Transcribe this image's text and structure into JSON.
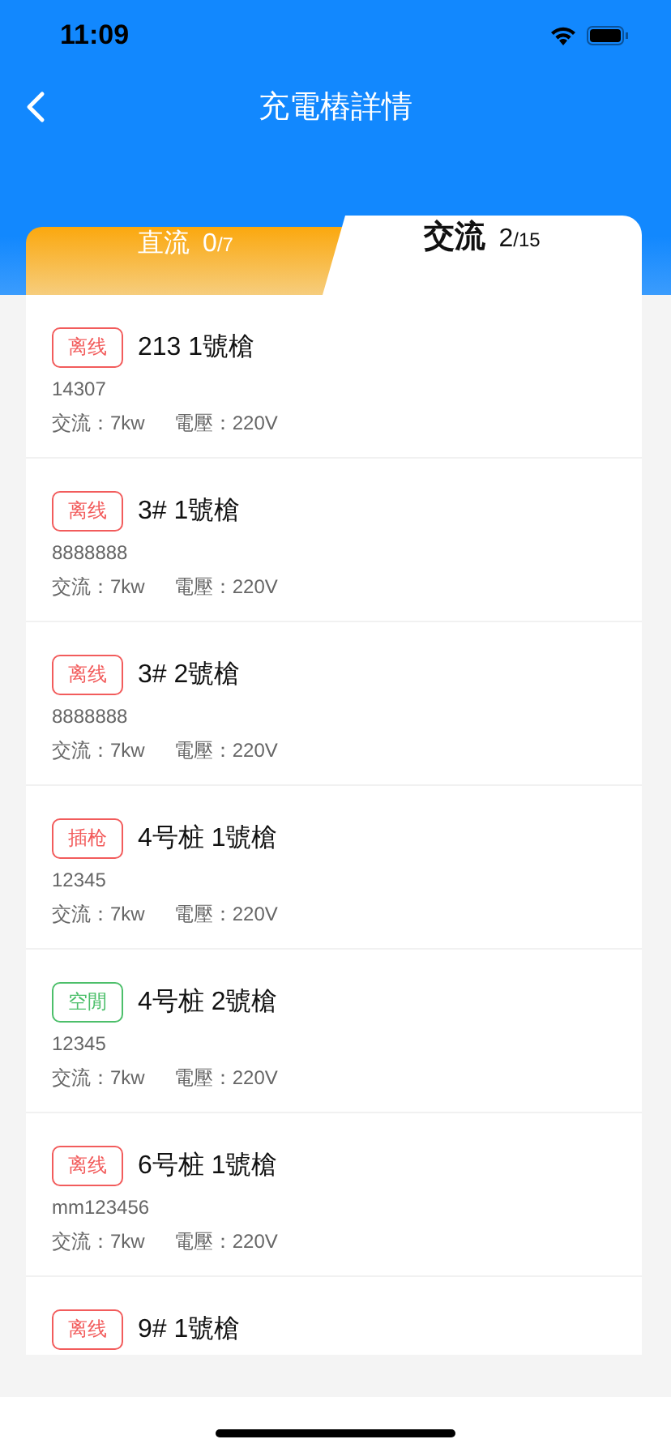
{
  "status_bar": {
    "time": "11:09"
  },
  "header": {
    "title": "充電樁詳情"
  },
  "tabs": [
    {
      "label": "直流",
      "count": "0",
      "total": "/7",
      "selected": false
    },
    {
      "label": "交流",
      "count": "2",
      "total": "/15",
      "selected": true
    }
  ],
  "guns": [
    {
      "status": "离线",
      "color": "#f25c5c",
      "name": "213 1號槍",
      "code": "14307",
      "power": "交流：7kw",
      "voltage": "電壓：220V"
    },
    {
      "status": "离线",
      "color": "#f25c5c",
      "name": "3# 1號槍",
      "code": "8888888",
      "power": "交流：7kw",
      "voltage": "電壓：220V"
    },
    {
      "status": "离线",
      "color": "#f25c5c",
      "name": "3# 2號槍",
      "code": "8888888",
      "power": "交流：7kw",
      "voltage": "電壓：220V"
    },
    {
      "status": "插枪",
      "color": "#f25c5c",
      "name": "4号桩 1號槍",
      "code": "12345",
      "power": "交流：7kw",
      "voltage": "電壓：220V"
    },
    {
      "status": "空閒",
      "color": "#4cbf6a",
      "name": "4号桩 2號槍",
      "code": "12345",
      "power": "交流：7kw",
      "voltage": "電壓：220V"
    },
    {
      "status": "离线",
      "color": "#f25c5c",
      "name": "6号桩 1號槍",
      "code": "mm123456",
      "power": "交流：7kw",
      "voltage": "電壓：220V"
    },
    {
      "status": "离线",
      "color": "#f25c5c",
      "name": "9# 1號槍"
    }
  ]
}
